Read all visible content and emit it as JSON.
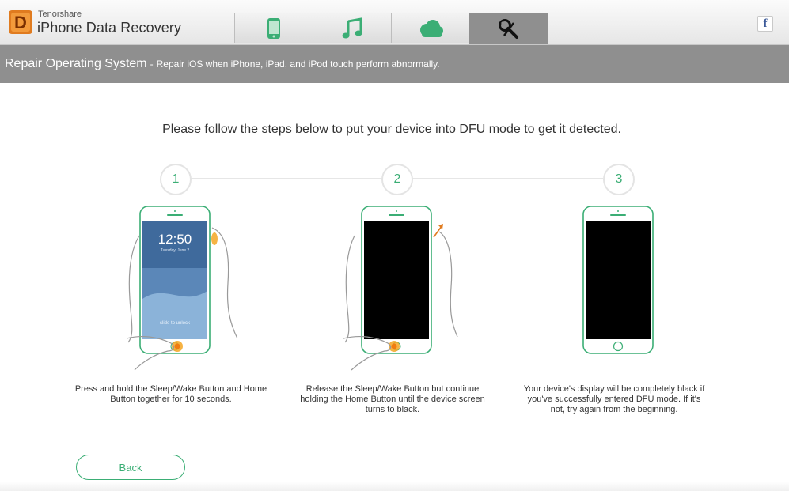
{
  "app": {
    "brand_small": "Tenorshare",
    "brand_title": "iPhone Data Recovery",
    "logo_letter": "D"
  },
  "tabs": [
    {
      "icon": "phone-icon",
      "active": false
    },
    {
      "icon": "music-note-icon",
      "active": false
    },
    {
      "icon": "cloud-icon",
      "active": false
    },
    {
      "icon": "repair-tools-icon",
      "active": true
    }
  ],
  "social": {
    "facebook_label": "f"
  },
  "header": {
    "title": "Repair Operating System",
    "separator": "-",
    "subtitle": "Repair iOS when iPhone, iPad, and iPod touch perform abnormally."
  },
  "instruction": "Please follow the steps below to put your device into DFU mode to get it detected.",
  "steps": [
    {
      "number": "1",
      "caption": "Press and hold the Sleep/Wake Button and Home Button together for 10 seconds.",
      "screen_time": "12:50",
      "screen_date": "Tuesday, June 2",
      "screen_unlock": "slide to unlock"
    },
    {
      "number": "2",
      "caption": "Release the Sleep/Wake Button but continue holding the Home Button until the device screen turns to black."
    },
    {
      "number": "3",
      "caption": "Your device's display will be completely black if you've successfully entered DFU mode. If it's not, try again from the beginning."
    }
  ],
  "back_button": "Back",
  "colors": {
    "accent_green": "#3bae75",
    "header_gray": "#8f8f8f",
    "highlight_orange": "#f5a623",
    "logo_orange": "#e07b1f"
  }
}
